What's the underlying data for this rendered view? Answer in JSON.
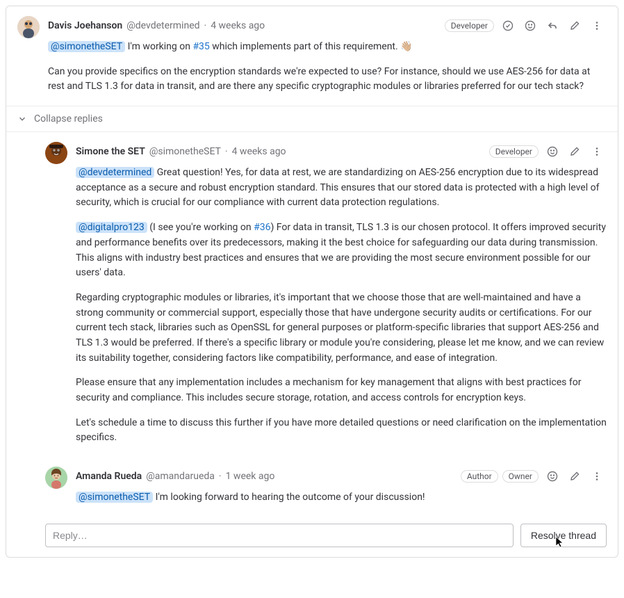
{
  "comments": [
    {
      "author_name": "Davis Joehanson",
      "author_handle": "@devdetermined",
      "time": "4 weeks ago",
      "badges": [
        "Developer"
      ],
      "mention1": "@simonetheSET",
      "text_after_mention1": " I'm working on ",
      "issue_link": "#35",
      "text_after_issue": " which implements part of this requirement. 👋🏼",
      "para2": "Can you provide specifics on the encryption standards we're expected to use? For instance, should we use AES-256 for data at rest and TLS 1.3 for data in transit, and are there any specific cryptographic modules or libraries preferred for our tech stack?"
    },
    {
      "author_name": "Simone the SET",
      "author_handle": "@simonetheSET",
      "time": "4 weeks ago",
      "badges": [
        "Developer"
      ],
      "p1_mention": "@devdetermined",
      "p1_rest": " Great question! Yes, for data at rest, we are standardizing on AES-256 encryption due to its widespread acceptance as a secure and robust encryption standard. This ensures that our stored data is protected with a high level of security, which is crucial for our compliance with current data protection regulations.",
      "p2_mention": "@digitalpro123",
      "p2_mid1": " (I see you're working on ",
      "p2_issue": "#36",
      "p2_rest": ") For data in transit, TLS 1.3 is our chosen protocol. It offers improved security and performance benefits over its predecessors, making it the best choice for safeguarding our data during transmission. This aligns with industry best practices and ensures that we are providing the most secure environment possible for our users' data.",
      "p3": "Regarding cryptographic modules or libraries, it's important that we choose those that are well-maintained and have a strong community or commercial support, especially those that have undergone security audits or certifications. For our current tech stack, libraries such as OpenSSL for general purposes or platform-specific libraries that support AES-256 and TLS 1.3 would be preferred. If there's a specific library or module you're considering, please let me know, and we can review its suitability together, considering factors like compatibility, performance, and ease of integration.",
      "p4": "Please ensure that any implementation includes a mechanism for key management that aligns with best practices for security and compliance. This includes secure storage, rotation, and access controls for encryption keys.",
      "p5": "Let's schedule a time to discuss this further if you have more detailed questions or need clarification on the implementation specifics."
    },
    {
      "author_name": "Amanda Rueda",
      "author_handle": "@amandarueda",
      "time": "1 week ago",
      "badges": [
        "Author",
        "Owner"
      ],
      "mention": "@simonetheSET",
      "rest": " I'm looking forward to hearing the outcome of your discussion!"
    }
  ],
  "collapse_label": "Collapse replies",
  "reply_placeholder": "Reply…",
  "resolve_label": "Resolve thread",
  "sep": "·"
}
